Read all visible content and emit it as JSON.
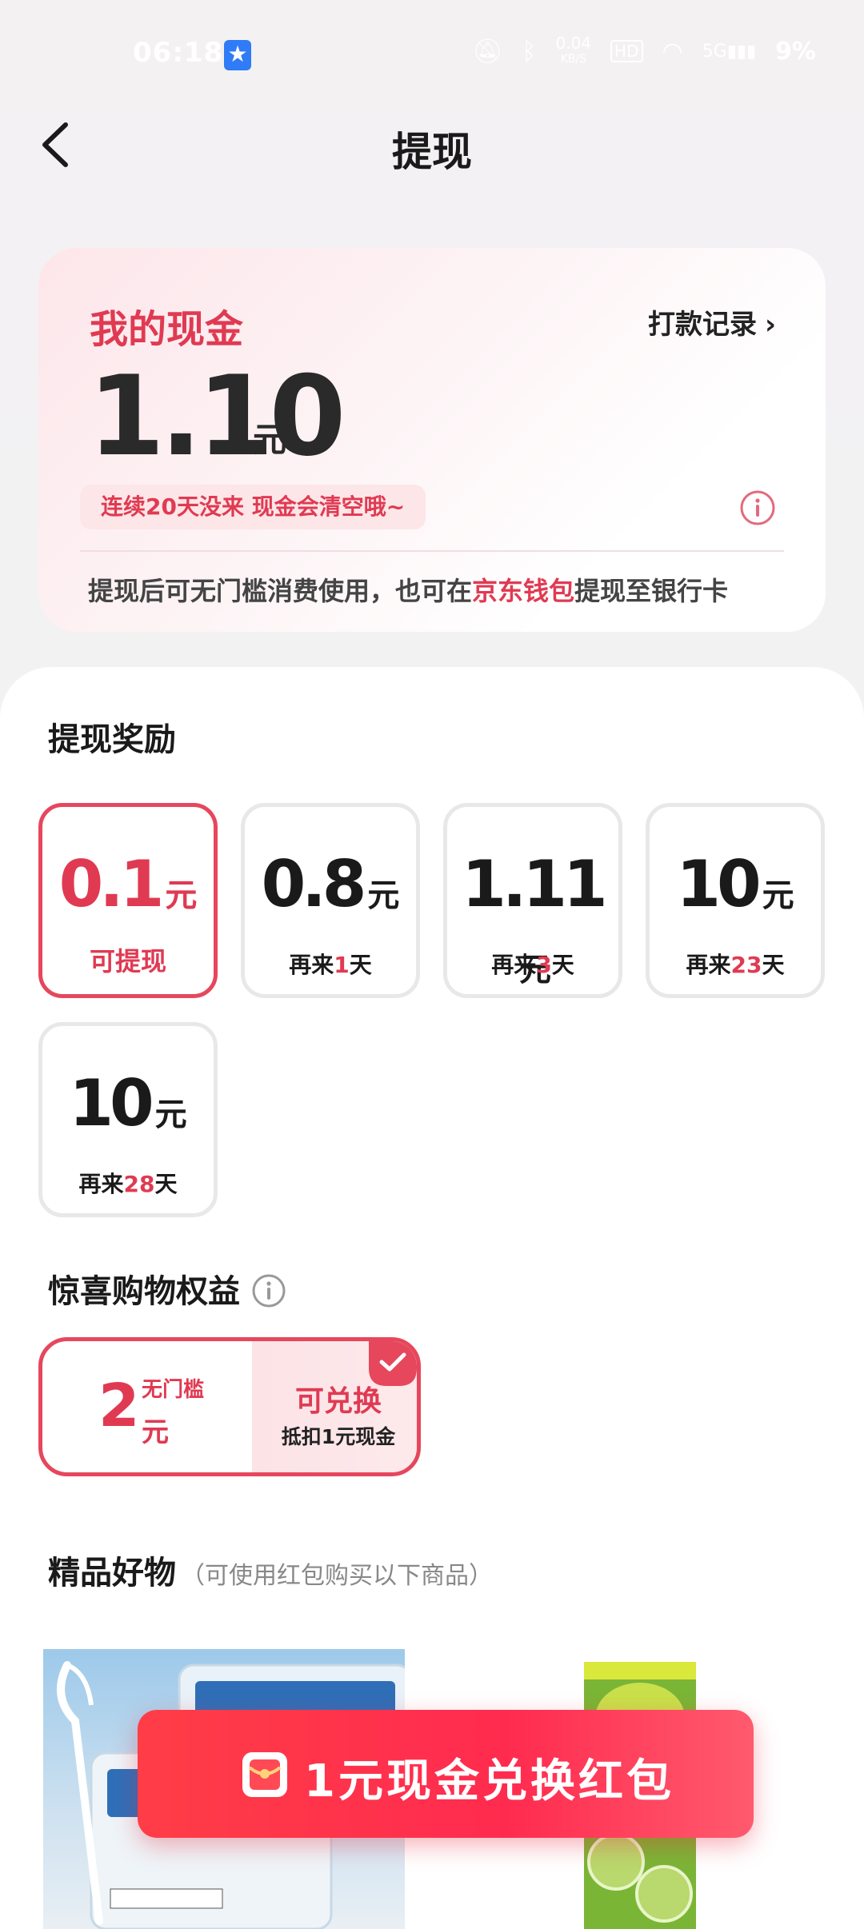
{
  "status_bar": {
    "time": "06:18",
    "net_speed": "0.04",
    "net_unit": "KB/S",
    "hd": "HD",
    "signal_label": "5G",
    "battery": "9%"
  },
  "nav": {
    "title": "提现"
  },
  "cash_card": {
    "title": "我的现金",
    "record_link": "打款记录",
    "amount": "1.10",
    "unit": "元",
    "warning": "连续20天没来 现金会清空哦~",
    "desc_prefix": "提现后可无门槛消费使用，也可在",
    "desc_highlight": "京东钱包",
    "desc_suffix": "提现至银行卡"
  },
  "rewards": {
    "title": "提现奖励",
    "unit": "元",
    "items": [
      {
        "amount": "0.1",
        "label": "可提现"
      },
      {
        "amount": "0.8",
        "label_prefix": "再来",
        "days": "1",
        "label_suffix": "天"
      },
      {
        "amount": "1.11",
        "label_prefix": "再来",
        "days": "3",
        "label_suffix": "天"
      },
      {
        "amount": "10",
        "label_prefix": "再来",
        "days": "23",
        "label_suffix": "天"
      },
      {
        "amount": "10",
        "label_prefix": "再来",
        "days": "28",
        "label_suffix": "天"
      }
    ]
  },
  "benefits": {
    "title": "惊喜购物权益",
    "card": {
      "amount": "2",
      "tag": "无门槛",
      "unit": "元",
      "action": "可兑换",
      "note": "抵扣1元现金"
    }
  },
  "goods": {
    "title": "精品好物",
    "subtitle": "（可使用红包购买以下商品）"
  },
  "cta": {
    "label": "1元现金兑换红包"
  },
  "colors": {
    "accent": "#e03a52",
    "cta": "#ff2b4f"
  }
}
